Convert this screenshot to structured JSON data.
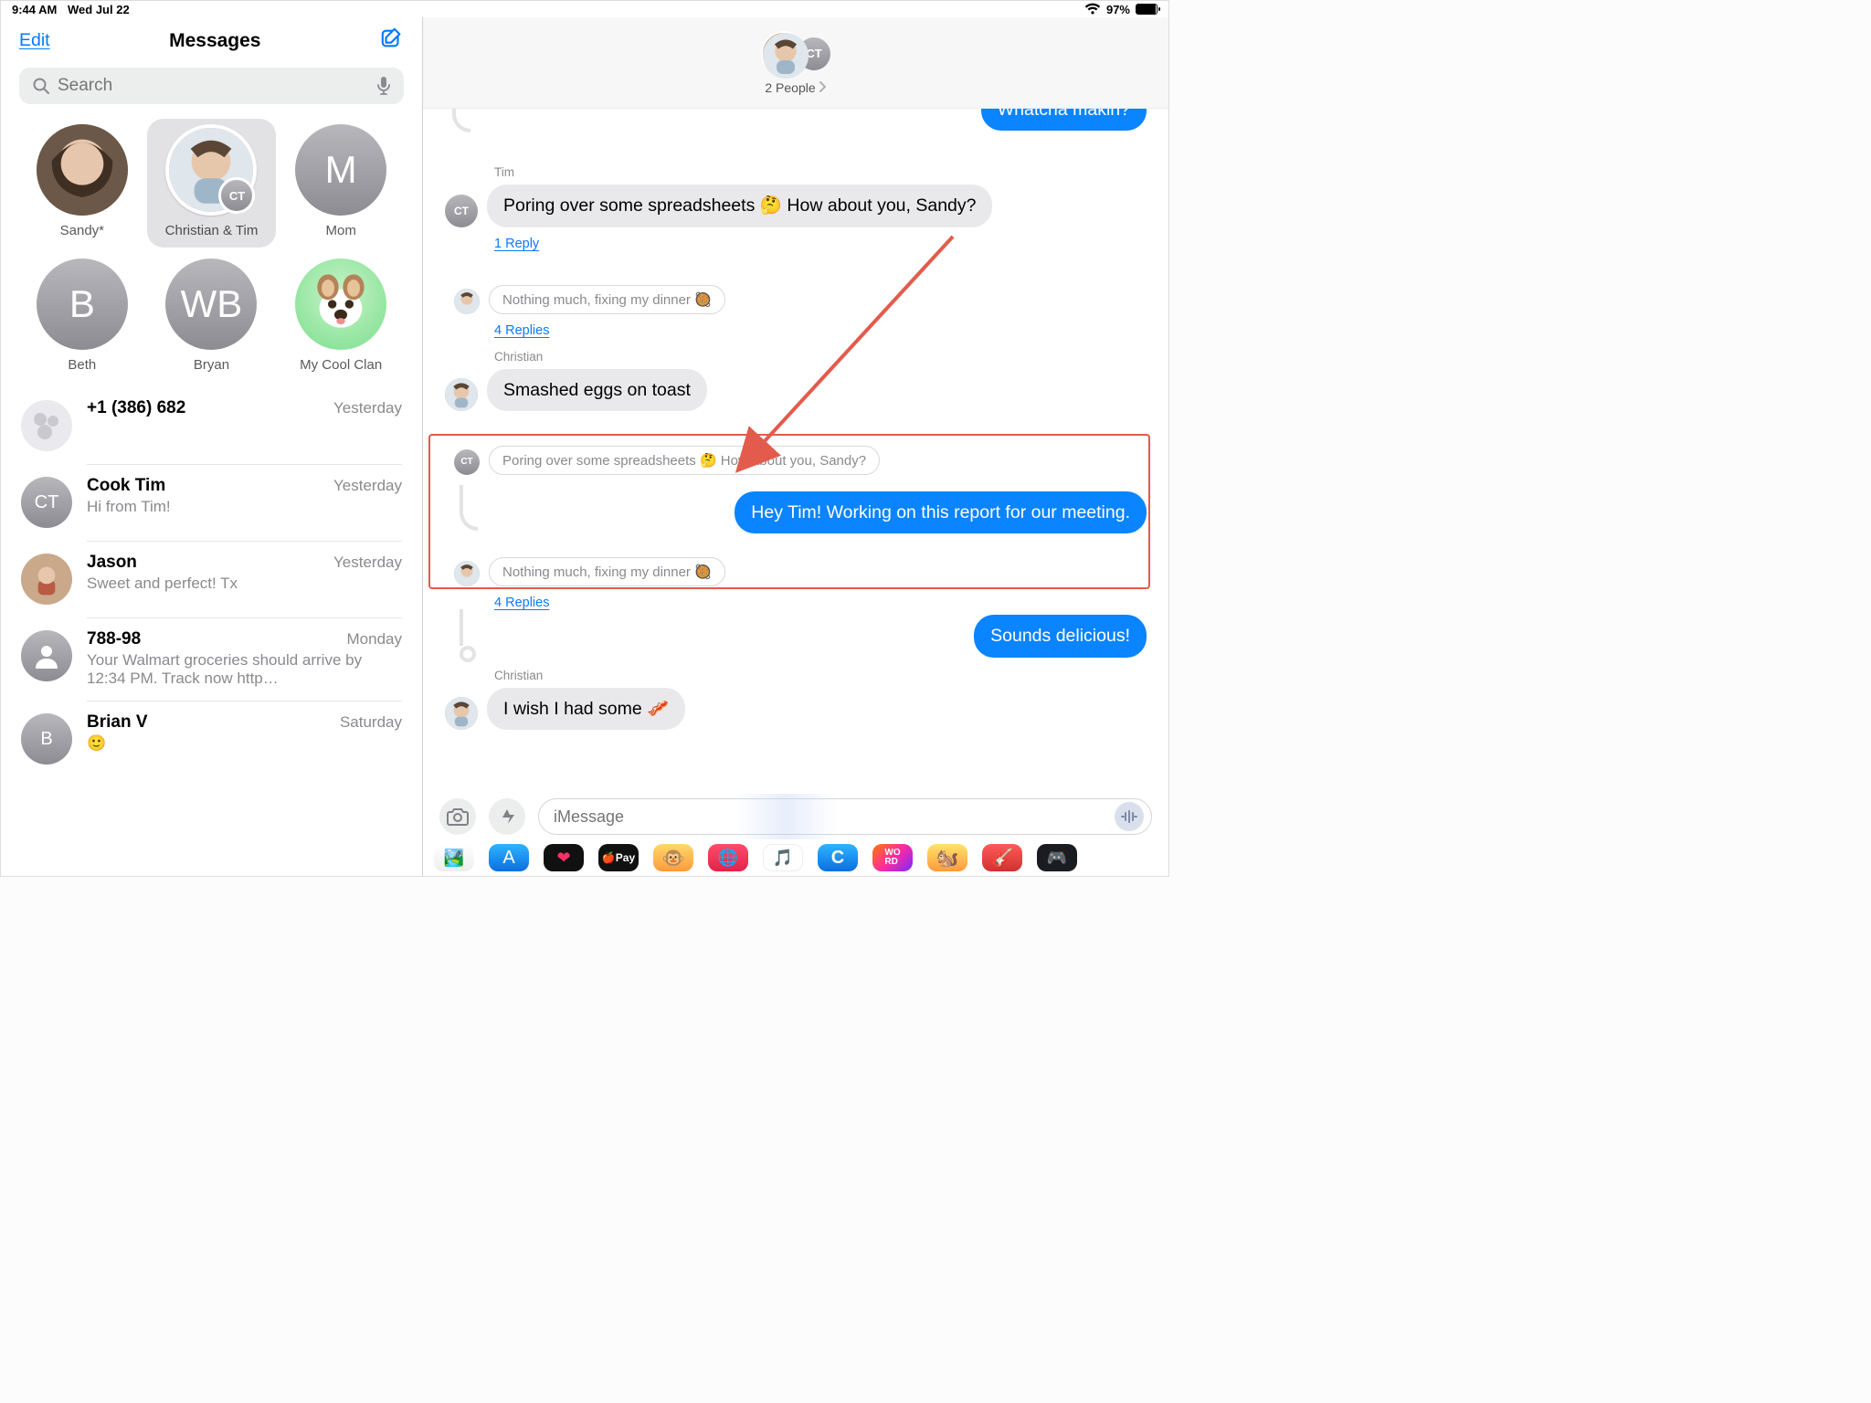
{
  "status": {
    "time": "9:44 AM",
    "date": "Wed Jul 22",
    "battery_pct": "97%"
  },
  "sidebar": {
    "edit": "Edit",
    "title": "Messages",
    "search_placeholder": "Search",
    "pinned": [
      {
        "name": "Sandy*",
        "initials": "",
        "kind": "photo"
      },
      {
        "name": "Christian & Tim",
        "initials": "",
        "kind": "pair",
        "overlay": "CT",
        "selected": true
      },
      {
        "name": "Mom",
        "initials": "M",
        "kind": "letter"
      },
      {
        "name": "Beth",
        "initials": "B",
        "kind": "letter"
      },
      {
        "name": "Bryan",
        "initials": "WB",
        "kind": "letter"
      },
      {
        "name": "My Cool Clan",
        "initials": "",
        "kind": "memoji"
      }
    ],
    "threads": [
      {
        "who": "+1 (386) 682",
        "when": "Yesterday",
        "preview": "",
        "avatar": "group"
      },
      {
        "who": "Cook Tim",
        "when": "Yesterday",
        "preview": "Hi from Tim!",
        "avatar": "CT"
      },
      {
        "who": "Jason",
        "when": "Yesterday",
        "preview": "Sweet and perfect! Tx",
        "avatar": "photo"
      },
      {
        "who": "788-98",
        "when": "Monday",
        "preview": "Your Walmart groceries should arrive by 12:34 PM. Track now http…",
        "avatar": "person"
      },
      {
        "who": "Brian V",
        "when": "Saturday",
        "preview": "🙂",
        "avatar": "B"
      }
    ]
  },
  "chat": {
    "header_people": "2 People",
    "header_overlay": "CT",
    "messages": [
      {
        "type": "out",
        "text": "Whatcha makin?",
        "partial": true
      },
      {
        "type": "sender",
        "text": "Tim"
      },
      {
        "type": "in",
        "av": "CT",
        "text": "Poring over some spreadsheets 🤔 How about you, Sandy?"
      },
      {
        "type": "replies",
        "text": "1 Reply"
      },
      {
        "type": "quote",
        "av": "photo",
        "text": "Nothing much, fixing my dinner 🥘"
      },
      {
        "type": "replies",
        "text": "4 Replies"
      },
      {
        "type": "sender",
        "text": "Christian"
      },
      {
        "type": "in",
        "av": "photo",
        "text": "Smashed eggs on toast"
      },
      {
        "type": "quote",
        "av": "CT",
        "text": "Poring over some spreadsheets 🤔 How about you, Sandy?"
      },
      {
        "type": "out",
        "text": "Hey Tim! Working on this report for our meeting."
      },
      {
        "type": "quote",
        "av": "photo",
        "text": "Nothing much, fixing my dinner 🥘"
      },
      {
        "type": "replies",
        "text": "4 Replies"
      },
      {
        "type": "out",
        "text": "Sounds delicious!"
      },
      {
        "type": "sender",
        "text": "Christian"
      },
      {
        "type": "in",
        "av": "photo",
        "text": "I wish I had some 🥓"
      }
    ],
    "input_placeholder": "iMessage"
  }
}
